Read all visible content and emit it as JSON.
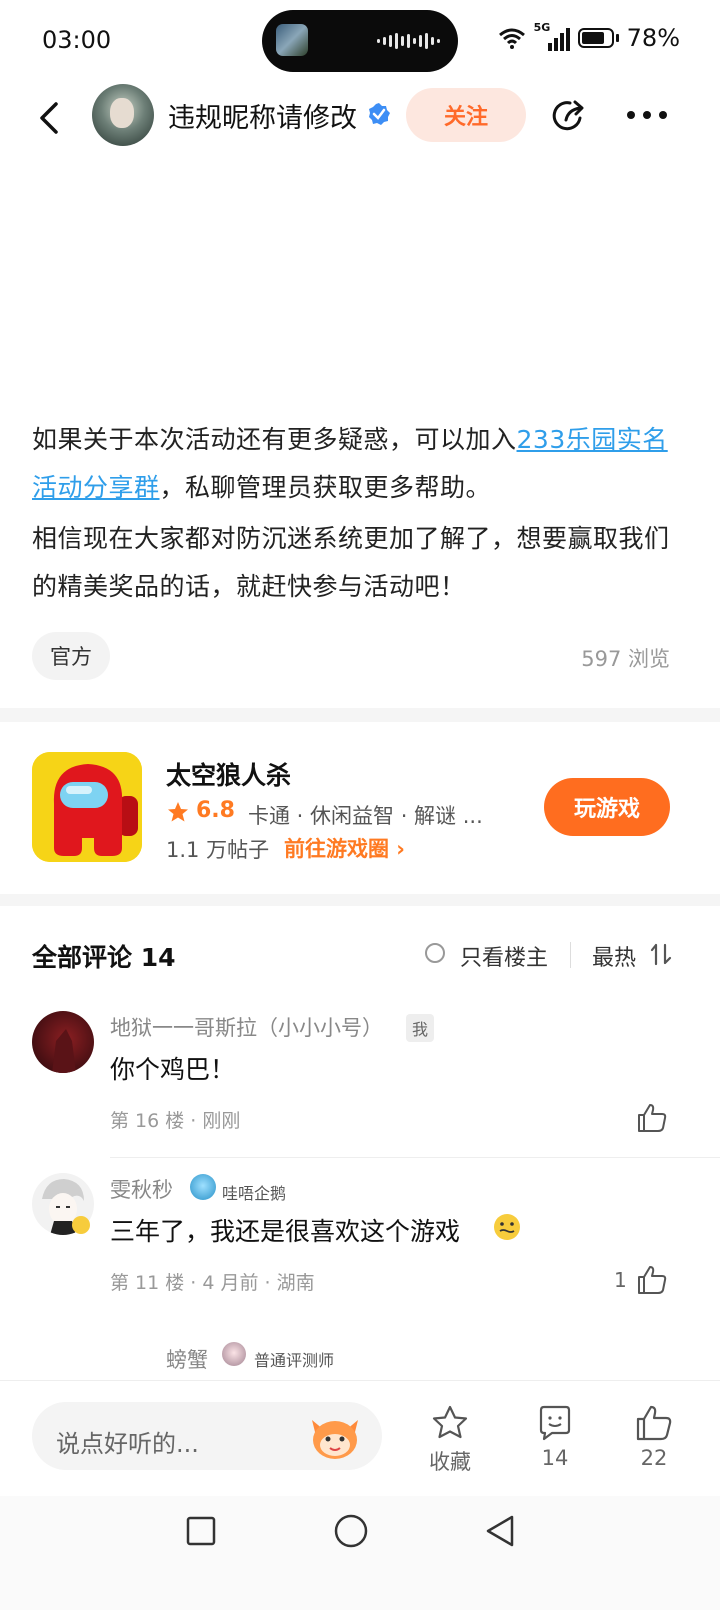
{
  "status_bar": {
    "time": "03:00",
    "network": "5G",
    "battery": "78%"
  },
  "header": {
    "user_name": "违规昵称请修改",
    "follow_label": "关注"
  },
  "article": {
    "para1_before": "如果关于本次活动还有更多疑惑，可以加入",
    "para1_link": "233乐园实名活动分享群",
    "para1_after": "，私聊管理员获取更多帮助。",
    "para2": "相信现在大家都对防沉迷系统更加了解了，想要赢取我们的精美奖品的话，就赶快参与活动吧！",
    "tag": "官方",
    "views": "597 浏览"
  },
  "game": {
    "title": "太空狼人杀",
    "score": "6.8",
    "tags": "卡通 · 休闲益智 · 解谜 ...",
    "posts": "1.1 万帖子",
    "circle_link": "前往游戏圈 ›",
    "play_label": "玩游戏"
  },
  "comments_header": {
    "title": "全部评论 14",
    "op_only": "只看楼主",
    "sort": "最热"
  },
  "comments": [
    {
      "name": "地狱一一哥斯拉（小小小号）",
      "badge": "我",
      "text": "你个鸡巴！",
      "meta": "第 16 楼 · 刚刚",
      "likes": ""
    },
    {
      "name": "雯秋秒",
      "badge": "哇唔企鹅",
      "text": "三年了，我还是很喜欢这个游戏",
      "meta": "第 11 楼 · 4 月前 · 湖南",
      "likes": "1"
    },
    {
      "name": "螃蟹",
      "badge": "普通评测师"
    }
  ],
  "bottom_bar": {
    "input_placeholder": "说点好听的...",
    "collect_label": "收藏",
    "comment_count": "14",
    "like_count": "22"
  },
  "colors": {
    "accent": "#ff6d1f",
    "link": "#2f9eea",
    "follow_bg": "#fde7df"
  }
}
